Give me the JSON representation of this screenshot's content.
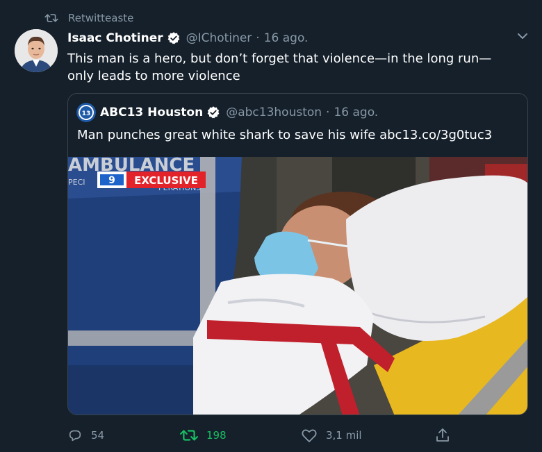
{
  "retweet": {
    "label": "Retwitteaste",
    "icon": "retweet-icon"
  },
  "tweet": {
    "author_name": "Isaac Chotiner",
    "handle": "@IChotiner",
    "dot": "·",
    "date": "16 ago.",
    "text": "This man is a hero, but don’t forget that violence—in the long run—only leads to more violence",
    "verified": true
  },
  "quote": {
    "avatar_text": "abc 13",
    "author_name": "ABC13 Houston",
    "handle": "@abc13houston",
    "dot": "·",
    "date": "16 ago.",
    "text": "Man punches great white shark to save his wife abc13.co/3g0tuc3",
    "verified": true,
    "media": {
      "sign_top": "AMBULANCE",
      "sign_left": "PECI",
      "sign_right": "PERATIONS",
      "channel_logo": "9",
      "badge": "EXCLUSIVE"
    }
  },
  "actions": {
    "reply_count": "54",
    "retweet_count": "198",
    "like_count": "3,1 mil"
  },
  "colors": {
    "background": "#15202b",
    "secondary_text": "#8899a6",
    "retweet_active": "#17bf63",
    "border": "#38444d",
    "verified": "#ffffff"
  }
}
